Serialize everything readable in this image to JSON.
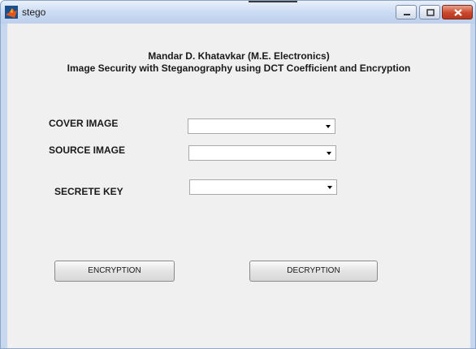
{
  "window": {
    "title": "stego",
    "title_bar_colors": {
      "top": "#e9f0fb",
      "bottom": "#bccfec",
      "close_button": "#c9472b"
    },
    "controls": [
      "minimize-icon",
      "maximize-icon",
      "close-icon"
    ]
  },
  "app_icon": "matlab-icon",
  "heading": {
    "line1": "Mandar D. Khatavkar (M.E. Electronics)",
    "line2": "Image Security with Steganography using DCT Coefficient and Encryption"
  },
  "form": {
    "cover_image": {
      "label": "COVER IMAGE",
      "value": ""
    },
    "source_image": {
      "label": "SOURCE IMAGE",
      "value": ""
    },
    "secret_key": {
      "label": "SECRETE KEY",
      "value": ""
    }
  },
  "buttons": {
    "encryption": "ENCRYPTION",
    "decryption": "DECRYPTION"
  },
  "colors": {
    "client_background": "#f0f0f0"
  }
}
